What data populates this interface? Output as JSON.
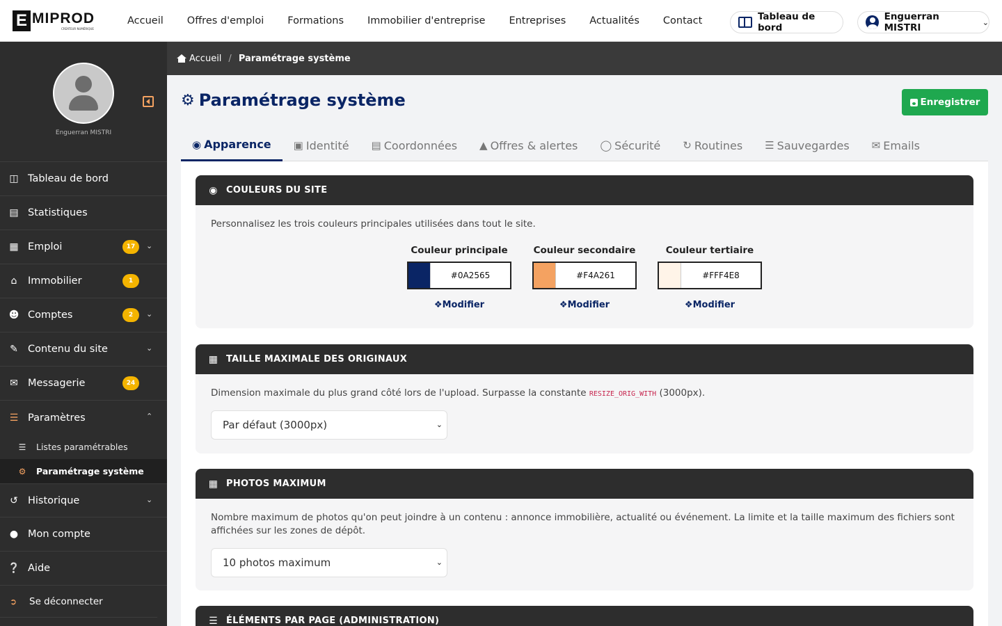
{
  "brand": {
    "logo_letter": "E",
    "logo_text": "MIPROD",
    "tagline": "CRÉATEUR NUMÉRIQUE"
  },
  "topnav": {
    "links": [
      "Accueil",
      "Offres d'emploi",
      "Formations",
      "Immobilier d'entreprise",
      "Entreprises",
      "Actualités",
      "Contact"
    ],
    "dashboard_label": "Tableau de bord",
    "user_label": "Enguerran MISTRI"
  },
  "sidebar": {
    "profile_name": "Enguerran MISTRI",
    "items": [
      {
        "label": "Tableau de bord",
        "icon": "dashboard-icon"
      },
      {
        "label": "Statistiques",
        "icon": "chart-icon"
      },
      {
        "label": "Emploi",
        "icon": "briefcase-icon",
        "badge": "17",
        "chevron": "down"
      },
      {
        "label": "Immobilier",
        "icon": "home-icon",
        "badge": "1"
      },
      {
        "label": "Comptes",
        "icon": "users-icon",
        "badge": "2",
        "chevron": "down"
      },
      {
        "label": "Contenu du site",
        "icon": "pen-icon",
        "chevron": "down"
      },
      {
        "label": "Messagerie",
        "icon": "comments-icon",
        "badge": "24"
      },
      {
        "label": "Paramètres",
        "icon": "sliders-icon",
        "chevron": "up"
      }
    ],
    "subitems": [
      {
        "label": "Listes paramétrables",
        "icon": "sliders-icon"
      },
      {
        "label": "Paramétrage système",
        "icon": "gear-icon",
        "active": true
      }
    ],
    "items_after": [
      {
        "label": "Historique",
        "icon": "history-icon",
        "chevron": "down"
      },
      {
        "label": "Mon compte",
        "icon": "user-circle-icon"
      },
      {
        "label": "Aide",
        "icon": "help-icon"
      }
    ],
    "logout_label": "Se déconnecter"
  },
  "breadcrumb": {
    "home": "Accueil",
    "current": "Paramétrage système"
  },
  "page": {
    "title": "Paramétrage système",
    "save_label": "Enregistrer"
  },
  "tabs": [
    "Apparence",
    "Identité",
    "Coordonnées",
    "Offres & alertes",
    "Sécurité",
    "Routines",
    "Sauvegardes",
    "Emails"
  ],
  "colors_card": {
    "title": "COULEURS DU SITE",
    "desc": "Personnalisez les trois couleurs principales utilisées dans tout le site.",
    "modify_label": "Modifier",
    "swatches": [
      {
        "label": "Couleur principale",
        "hex": "#0A2565",
        "color": "#0a2565"
      },
      {
        "label": "Couleur secondaire",
        "hex": "#F4A261",
        "color": "#f4a261"
      },
      {
        "label": "Couleur tertiaire",
        "hex": "#FFF4E8",
        "color": "#fff4e8"
      }
    ]
  },
  "size_card": {
    "title": "TAILLE MAXIMALE DES ORIGINAUX",
    "desc_before": "Dimension maximale du plus grand côté lors de l'upload. Surpasse la constante ",
    "desc_code": "RESIZE_ORIG_WITH",
    "desc_after": " (3000px).",
    "select_value": "Par défaut (3000px)"
  },
  "photos_card": {
    "title": "PHOTOS MAXIMUM",
    "desc": "Nombre maximum de photos qu'on peut joindre à un contenu : annonce immobilière, actualité ou événement. La limite et la taille maximum des fichiers sont affichées sur les zones de dépôt.",
    "select_value": "10 photos maximum"
  },
  "elements_card": {
    "title": "ÉLÉMENTS PAR PAGE (ADMINISTRATION)"
  }
}
